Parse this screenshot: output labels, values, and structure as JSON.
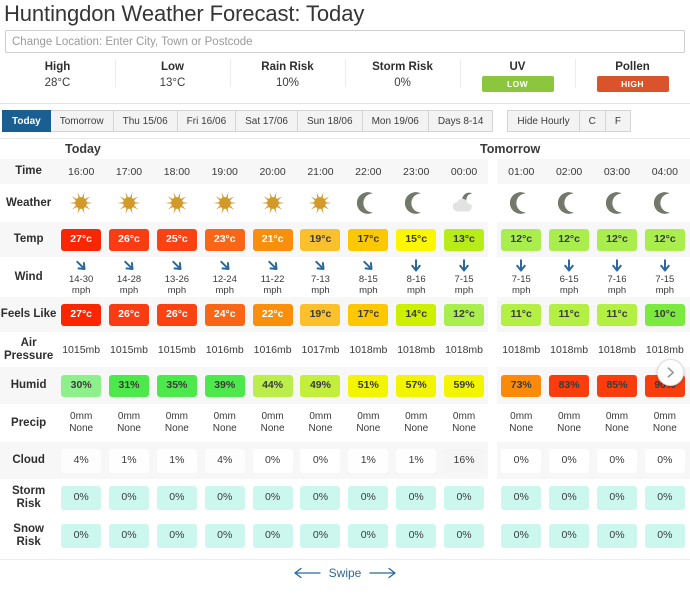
{
  "header": {
    "title": "Huntingdon Weather Forecast: Today"
  },
  "search": {
    "placeholder": "Change Location: Enter City, Town or Postcode",
    "value": ""
  },
  "summary": [
    {
      "label": "High",
      "value": "28°C",
      "type": "text"
    },
    {
      "label": "Low",
      "value": "13°C",
      "type": "text"
    },
    {
      "label": "Rain Risk",
      "value": "10%",
      "type": "text"
    },
    {
      "label": "Storm Risk",
      "value": "0%",
      "type": "text"
    },
    {
      "label": "UV",
      "value": "LOW",
      "type": "badge",
      "color": "#8cc63f"
    },
    {
      "label": "Pollen",
      "value": "HIGH",
      "type": "badge",
      "color": "#d9542a"
    }
  ],
  "tabs": {
    "days": [
      {
        "label": "Today",
        "active": true
      },
      {
        "label": "Tomorrow",
        "active": false
      },
      {
        "label": "Thu 15/06",
        "active": false
      },
      {
        "label": "Fri 16/06",
        "active": false
      },
      {
        "label": "Sat 17/06",
        "active": false
      },
      {
        "label": "Sun 18/06",
        "active": false
      },
      {
        "label": "Mon 19/06",
        "active": false
      },
      {
        "label": "Days 8-14",
        "active": false
      }
    ],
    "controls": [
      {
        "label": "Hide Hourly",
        "active": false
      },
      {
        "label": "C",
        "active": false
      },
      {
        "label": "F",
        "active": false
      }
    ]
  },
  "panels": {
    "today_label": "Tomorrow",
    "today_title": "Today",
    "tomorrow_title": "Tomorrow"
  },
  "rows": {
    "time": "Time",
    "weather": "Weather",
    "temp": "Temp",
    "wind": "Wind",
    "feels": "Feels Like",
    "pressure": "Air Pressure",
    "humid": "Humid",
    "precip": "Precip",
    "cloud": "Cloud",
    "storm": "Storm Risk",
    "snow": "Snow Risk"
  },
  "today": {
    "title": "Today",
    "times": [
      "16:00",
      "17:00",
      "18:00",
      "19:00",
      "20:00",
      "21:00",
      "22:00",
      "23:00",
      "00:00"
    ],
    "weather": [
      "sun",
      "sun",
      "sun",
      "sun",
      "sun",
      "sun",
      "moon",
      "moon",
      "cloud-moon"
    ],
    "temp": [
      "27°c",
      "26°c",
      "25°c",
      "23°c",
      "21°c",
      "19°c",
      "17°c",
      "15°c",
      "13°c"
    ],
    "temp_colors": [
      "#fa2600",
      "#f93c12",
      "#fb4312",
      "#f96716",
      "#fa8f0b",
      "#fcc02c",
      "#fdc800",
      "#fcf600",
      "#b7ec16"
    ],
    "temp_text_dark": [
      false,
      false,
      false,
      false,
      false,
      true,
      true,
      true,
      true
    ],
    "wind_dir": [
      "sw",
      "sw",
      "sw",
      "sw",
      "sw",
      "sw",
      "sw",
      "s",
      "s"
    ],
    "wind": [
      "14-30",
      "14-28",
      "13-26",
      "12-24",
      "11-22",
      "7-13",
      "8-15",
      "8-16",
      "7-15"
    ],
    "wind_unit": "mph",
    "feels": [
      "27°c",
      "26°c",
      "26°c",
      "24°c",
      "22°c",
      "19°c",
      "17°c",
      "14°c",
      "12°c"
    ],
    "feels_colors": [
      "#fa2600",
      "#f93c12",
      "#fb4312",
      "#f96716",
      "#fa8f0b",
      "#fcc02c",
      "#fdc800",
      "#ccf000",
      "#aaee4e"
    ],
    "feels_text_dark": [
      false,
      false,
      false,
      false,
      false,
      true,
      true,
      true,
      true
    ],
    "pressure": [
      "1015mb",
      "1015mb",
      "1015mb",
      "1016mb",
      "1016mb",
      "1017mb",
      "1018mb",
      "1018mb",
      "1018mb"
    ],
    "humid": [
      "30%",
      "31%",
      "35%",
      "39%",
      "44%",
      "49%",
      "51%",
      "57%",
      "59%"
    ],
    "humid_colors": [
      "#8ef08a",
      "#4de84b",
      "#4de84b",
      "#4de84b",
      "#bbee4a",
      "#c3ee3c",
      "#f2f400",
      "#f2f400",
      "#f2f400"
    ],
    "precip_mm": [
      "0mm",
      "0mm",
      "0mm",
      "0mm",
      "0mm",
      "0mm",
      "0mm",
      "0mm",
      "0mm"
    ],
    "precip_type": [
      "None",
      "None",
      "None",
      "None",
      "None",
      "None",
      "None",
      "None",
      "None"
    ],
    "cloud": [
      "4%",
      "1%",
      "1%",
      "4%",
      "0%",
      "0%",
      "1%",
      "1%",
      "16%"
    ],
    "cloud_shade": [
      0.04,
      0.01,
      0.01,
      0.04,
      0.0,
      0.0,
      0.01,
      0.01,
      0.16
    ],
    "storm": [
      "0%",
      "0%",
      "0%",
      "0%",
      "0%",
      "0%",
      "0%",
      "0%",
      "0%"
    ],
    "snow": [
      "0%",
      "0%",
      "0%",
      "0%",
      "0%",
      "0%",
      "0%",
      "0%",
      "0%"
    ]
  },
  "tomorrow": {
    "title": "Tomorrow",
    "times": [
      "01:00",
      "02:00",
      "03:00",
      "04:00"
    ],
    "weather": [
      "moon",
      "moon",
      "moon",
      "moon"
    ],
    "temp": [
      "12°c",
      "12°c",
      "12°c",
      "12°c"
    ],
    "temp_colors": [
      "#aaee4e",
      "#aaee4e",
      "#aaee4e",
      "#aaee4e"
    ],
    "temp_text_dark": [
      true,
      true,
      true,
      true
    ],
    "wind_dir": [
      "s",
      "s",
      "s",
      "s"
    ],
    "wind": [
      "7-15",
      "6-15",
      "7-16",
      "7-15"
    ],
    "wind_unit": "mph",
    "feels": [
      "11°c",
      "11°c",
      "11°c",
      "10°c"
    ],
    "feels_colors": [
      "#b4ef44",
      "#b4ef44",
      "#b4ef44",
      "#7aea3f"
    ],
    "feels_text_dark": [
      true,
      true,
      true,
      true
    ],
    "pressure": [
      "1018mb",
      "1018mb",
      "1018mb",
      "1018mb"
    ],
    "humid": [
      "73%",
      "83%",
      "85%",
      "90%"
    ],
    "humid_colors": [
      "#f98a0a",
      "#f93d0d",
      "#f93d0d",
      "#f93d0d"
    ],
    "precip_mm": [
      "0mm",
      "0mm",
      "0mm",
      "0mm"
    ],
    "precip_type": [
      "None",
      "None",
      "None",
      "None"
    ],
    "cloud": [
      "0%",
      "0%",
      "0%",
      "0%"
    ],
    "cloud_shade": [
      0.0,
      0.0,
      0.0,
      0.0
    ],
    "storm": [
      "0%",
      "0%",
      "0%",
      "0%"
    ],
    "snow": [
      "0%",
      "0%",
      "0%",
      "0%"
    ]
  },
  "footer": {
    "swipe_label": "Swipe"
  },
  "colors": {
    "tab_active": "#1a5f92",
    "risk_chip": "#ccf7ef",
    "sun_icon": "#d39a2a",
    "moon_icon": "#73796a",
    "cloud_icon": "#e2e2e2",
    "wind_arrow": "#2b6897",
    "link": "#2b6897"
  }
}
